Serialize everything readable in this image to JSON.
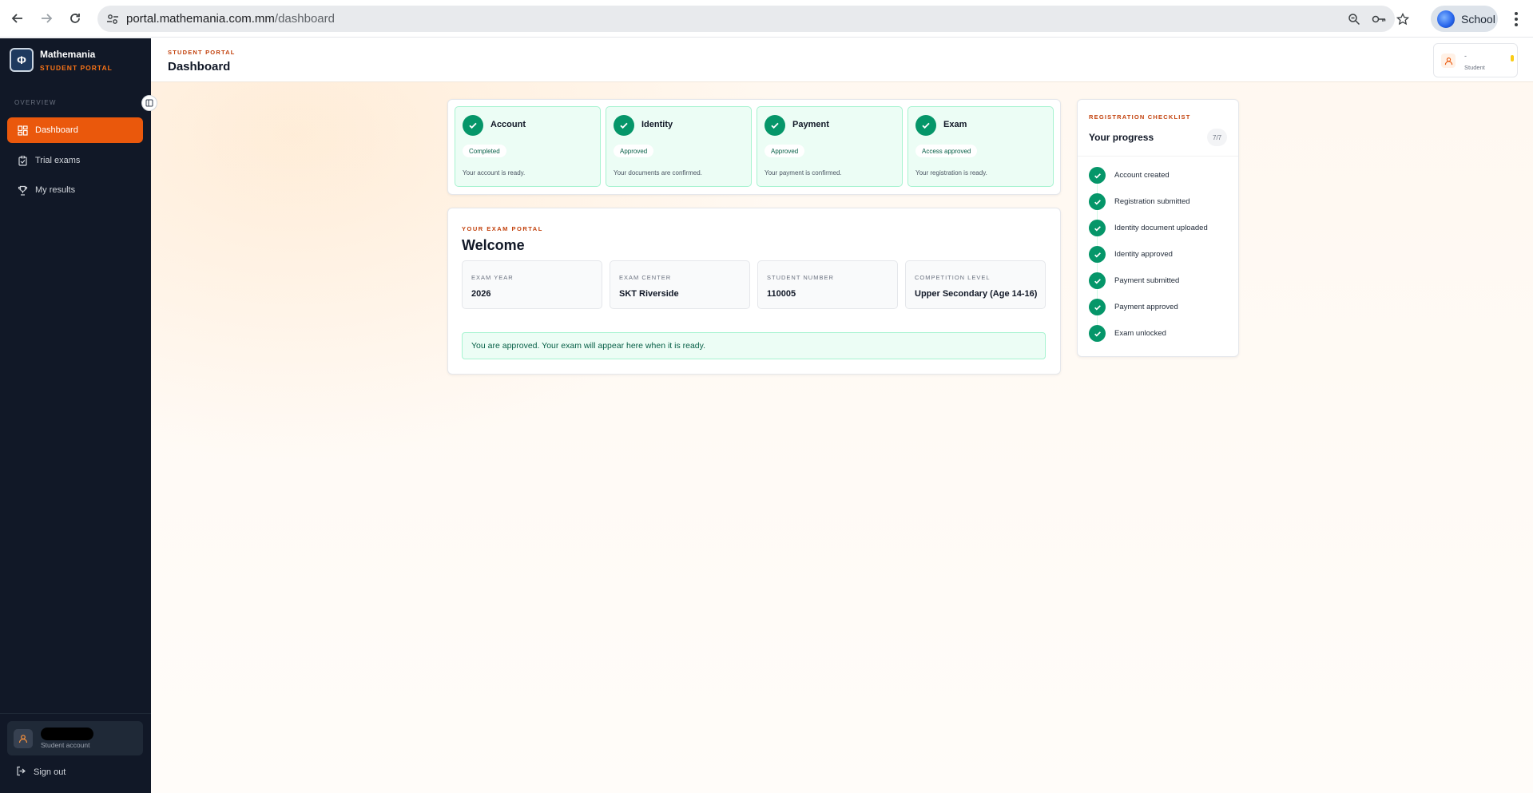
{
  "browser": {
    "url_host": "portal.mathemania.com.mm",
    "url_path": "/dashboard",
    "profile_name": "School"
  },
  "sidebar": {
    "brand_name": "Mathemania",
    "brand_sub": "STUDENT PORTAL",
    "section_label": "OVERVIEW",
    "items": [
      {
        "label": "Dashboard",
        "icon": "dashboard-grid-icon",
        "active": true
      },
      {
        "label": "Trial exams",
        "icon": "clipboard-check-icon",
        "active": false
      },
      {
        "label": "My results",
        "icon": "trophy-icon",
        "active": false
      }
    ],
    "user_role": "Student account",
    "signout_label": "Sign out"
  },
  "topbar": {
    "eyebrow": "STUDENT PORTAL",
    "title": "Dashboard",
    "account_name": "-",
    "account_role": "Student"
  },
  "status_cards": [
    {
      "title": "Account",
      "badge": "Completed",
      "desc": "Your account is ready."
    },
    {
      "title": "Identity",
      "badge": "Approved",
      "desc": "Your documents are confirmed."
    },
    {
      "title": "Payment",
      "badge": "Approved",
      "desc": "Your payment is confirmed."
    },
    {
      "title": "Exam",
      "badge": "Access approved",
      "desc": "Your registration is ready."
    }
  ],
  "portal": {
    "eyebrow": "YOUR EXAM PORTAL",
    "welcome": "Welcome",
    "info": [
      {
        "label": "EXAM YEAR",
        "value": "2026"
      },
      {
        "label": "EXAM CENTER",
        "value": "SKT Riverside"
      },
      {
        "label": "STUDENT NUMBER",
        "value": "110005"
      },
      {
        "label": "COMPETITION LEVEL",
        "value": "Upper Secondary (Age 14-16)"
      }
    ],
    "banner": "You are approved. Your exam will appear here when it is ready."
  },
  "checklist": {
    "eyebrow": "REGISTRATION CHECKLIST",
    "title": "Your progress",
    "count": "7/7",
    "items": [
      "Account created",
      "Registration submitted",
      "Identity document uploaded",
      "Identity approved",
      "Payment submitted",
      "Payment approved",
      "Exam unlocked"
    ]
  },
  "colors": {
    "accent": "#ea580c",
    "success": "#059669",
    "sidebar_bg": "#111827"
  }
}
